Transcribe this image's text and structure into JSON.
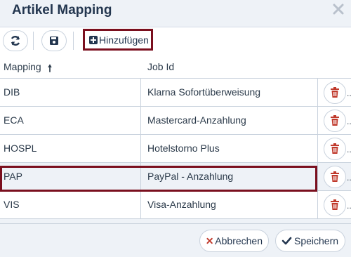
{
  "dialog": {
    "title": "Artikel Mapping"
  },
  "toolbar": {
    "add_label": "Hinzufügen"
  },
  "table": {
    "columns": [
      "Mapping",
      "Job Id"
    ],
    "sort_indicator": "🠕",
    "rows": [
      {
        "mapping": "DIB",
        "job_id": "Klarna Sofortüberweisung",
        "more": "..."
      },
      {
        "mapping": "ECA",
        "job_id": "Mastercard-Anzahlung",
        "more": "..."
      },
      {
        "mapping": "HOSPL",
        "job_id": "Hotelstorno Plus",
        "more": "..."
      },
      {
        "mapping": "PAP",
        "job_id": "PayPal - Anzahlung",
        "more": "..."
      },
      {
        "mapping": "VIS",
        "job_id": "Visa-Anzahlung",
        "more": "..."
      }
    ]
  },
  "footer": {
    "cancel_label": "Abbrechen",
    "save_label": "Speichern"
  },
  "colors": {
    "accent_border": "#7a0f1e",
    "delete_icon": "#c0392b",
    "text": "#23364f",
    "background": "#eef2f7"
  },
  "icons": {
    "refresh": "refresh-icon",
    "save": "save-icon",
    "add": "plus-square-icon",
    "delete": "trash-icon",
    "close": "close-icon",
    "cancel": "x-icon",
    "confirm": "check-icon"
  }
}
